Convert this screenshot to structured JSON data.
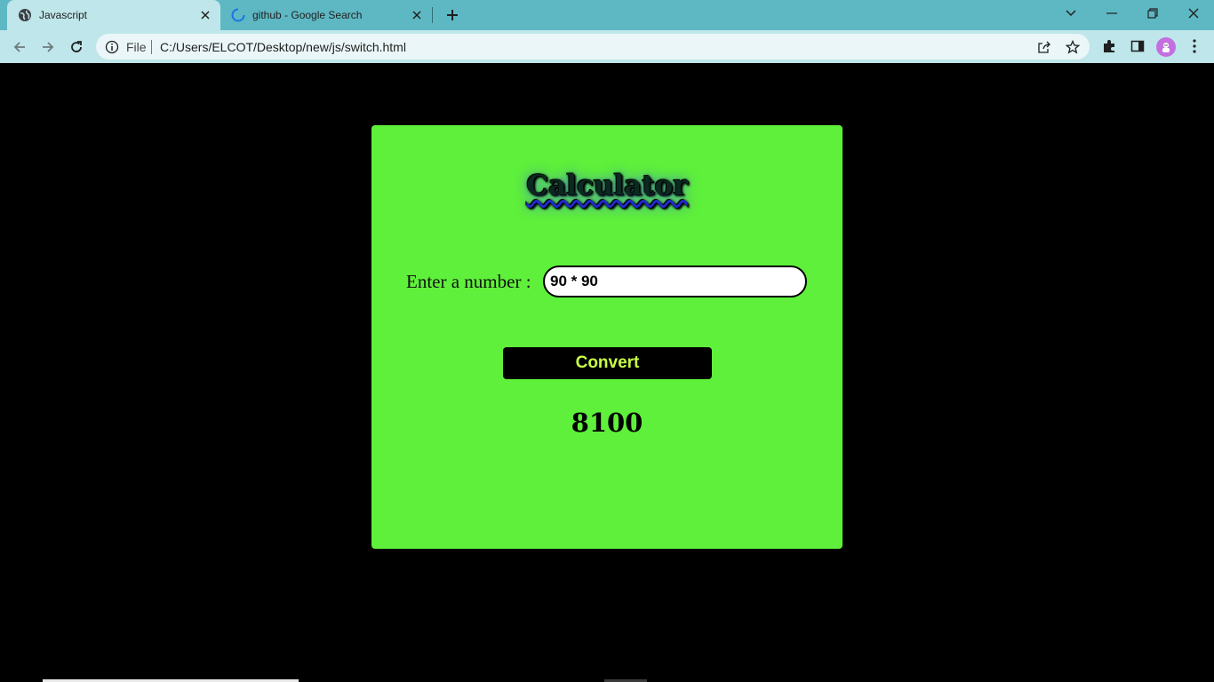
{
  "browser": {
    "tabs": [
      {
        "title": "Javascript",
        "icon": "globe-icon",
        "active": true
      },
      {
        "title": "github - Google Search",
        "icon": "loading-spinner-icon",
        "active": false
      }
    ],
    "address": {
      "scheme_label": "File",
      "url": "C:/Users/ELCOT/Desktop/new/js/switch.html"
    },
    "colors": {
      "tabstrip": "#5eb8c4",
      "toolbar": "#bfe6ea",
      "avatar": "#c36fe0"
    }
  },
  "page": {
    "title": "Calculator",
    "input_label": "Enter a number :",
    "input_value": "90 * 90",
    "convert_label": "Convert",
    "result": "8100",
    "colors": {
      "background": "#000000",
      "card": "#5ef03a",
      "button_text": "#c9ff45"
    }
  }
}
